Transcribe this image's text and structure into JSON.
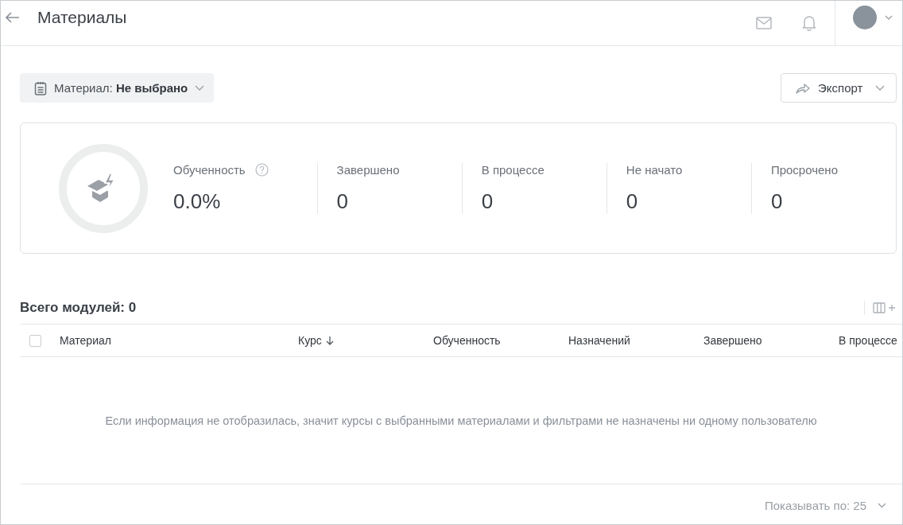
{
  "header": {
    "title": "Материалы"
  },
  "filter": {
    "label": "Материал:",
    "value": "Не выбрано"
  },
  "export_button": {
    "label": "Экспорт"
  },
  "stats": [
    {
      "label": "Обученность",
      "value": "0.0%",
      "help": true
    },
    {
      "label": "Завершено",
      "value": "0",
      "help": false
    },
    {
      "label": "В процессе",
      "value": "0",
      "help": false
    },
    {
      "label": "Не начато",
      "value": "0",
      "help": false
    },
    {
      "label": "Просрочено",
      "value": "0",
      "help": false
    }
  ],
  "table": {
    "title": "Всего модулей: 0",
    "select_all": {
      "checked": false
    },
    "columns": [
      {
        "label": "Материал",
        "sorted": false
      },
      {
        "label": "Курс",
        "sorted": true
      },
      {
        "label": "Обученность",
        "sorted": false
      },
      {
        "label": "Назначений",
        "sorted": false
      },
      {
        "label": "Завершено",
        "sorted": false
      },
      {
        "label": "В процессе",
        "sorted": false
      }
    ],
    "empty_message": "Если информация не отобразилась, значит курсы с выбранными материалами и фильтрами не назначены ни одному пользователю"
  },
  "pagination": {
    "label": "Показывать по: 25"
  }
}
